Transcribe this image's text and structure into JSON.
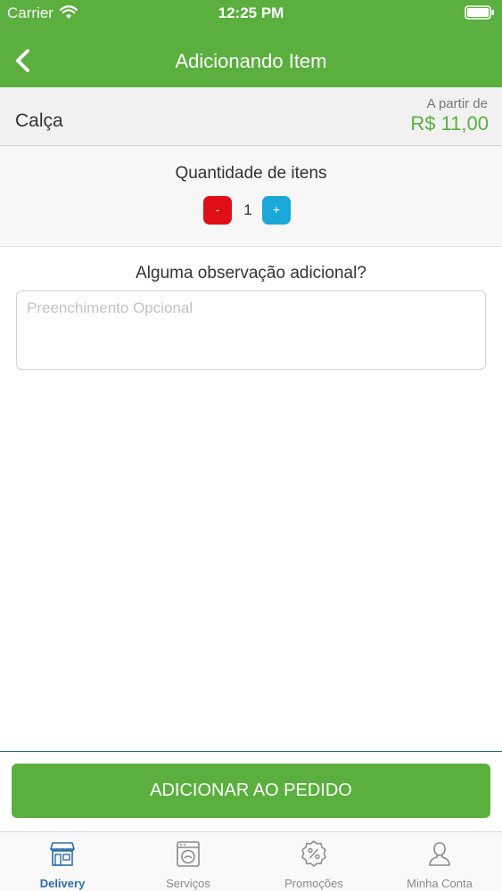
{
  "status": {
    "carrier": "Carrier",
    "time": "12:25 PM"
  },
  "nav": {
    "title": "Adicionando Item"
  },
  "item": {
    "name": "Calça",
    "from_label": "A partir de",
    "price": "R$ 11,00"
  },
  "quantity": {
    "label": "Quantidade de itens",
    "minus": "-",
    "value": "1",
    "plus": "+"
  },
  "observation": {
    "label": "Alguma observação adicional?",
    "placeholder": "Preenchimento Opcional",
    "value": ""
  },
  "action": {
    "add_label": "ADICIONAR AO PEDIDO"
  },
  "tabs": [
    {
      "label": "Delivery",
      "icon": "store-icon",
      "active": true
    },
    {
      "label": "Serviços",
      "icon": "washing-machine-icon",
      "active": false
    },
    {
      "label": "Promoções",
      "icon": "percent-badge-icon",
      "active": false
    },
    {
      "label": "Minha Conta",
      "icon": "user-icon",
      "active": false
    }
  ],
  "colors": {
    "brand_green": "#5aaf3e",
    "minus_red": "#e10e16",
    "plus_blue": "#19a8d8",
    "tab_active": "#2f6ea8"
  }
}
